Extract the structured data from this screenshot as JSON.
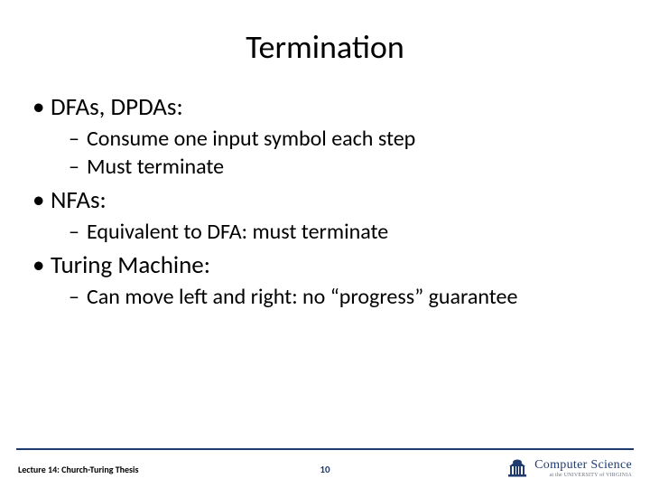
{
  "title": "Termination",
  "bullets": {
    "b1a": "DFAs, DPDAs:",
    "b1a_1": "Consume one input symbol each step",
    "b1a_2": "Must terminate",
    "b1b": "NFAs:",
    "b1b_1": "Equivalent  to DFA: must terminate",
    "b1c": "Turing Machine:",
    "b1c_1": "Can move left and right: no “progress” guarantee"
  },
  "footer": {
    "lecture": "Lecture 14: Church-Turing Thesis",
    "page": "10",
    "logo_main": "Computer Science",
    "logo_sub": "at the UNIVERSITY of VIRGINIA"
  }
}
